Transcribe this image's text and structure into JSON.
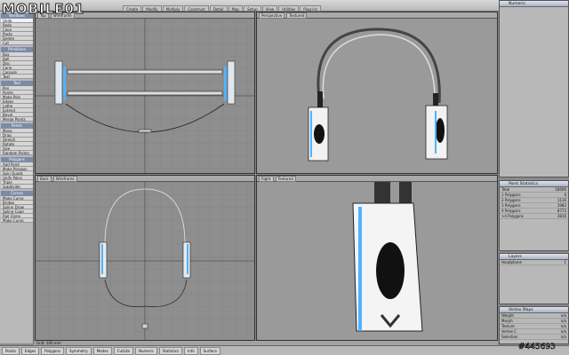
{
  "logo_text": "MOBILE01",
  "watermark": "#445693",
  "menu_tabs": [
    "Create",
    "Modify",
    "Multiply",
    "Construct",
    "Detail",
    "Map",
    "Setup",
    "View",
    "Utilities",
    "Plug-ins"
  ],
  "toolbar": {
    "groups": [
      {
        "title": "Windows",
        "items": [
          "Undo",
          "Redo",
          "Copy",
          "Paste",
          "Delete",
          "Cut"
        ]
      },
      {
        "title": "Primitives",
        "items": [
          "Box",
          "Ball",
          "Disc",
          "Cone",
          "Capsule",
          "Text"
        ]
      },
      {
        "title": "Tool",
        "items": [
          "Pen",
          "Points",
          "Make Poly",
          "Edges",
          "Lathe",
          "Extend",
          "Bevel",
          "Merge Points"
        ]
      },
      {
        "title": "Points",
        "items": [
          "Move",
          "Drag",
          "Stretch",
          "Rotate",
          "Size",
          "Random Points"
        ]
      },
      {
        "title": "Polygons",
        "items": [
          "Add Point",
          "Make Polygon",
          "Spin Quads",
          "Unify Polys",
          "Triple",
          "Subdivide"
        ]
      },
      {
        "title": "Curves",
        "items": [
          "Make Curve",
          "Bridge",
          "Spline Draw",
          "Spline Cage",
          "Rail Clone",
          "Make Curve"
        ]
      }
    ]
  },
  "viewports": {
    "top": {
      "label": "Top",
      "mode": "Wireframe"
    },
    "perspective": {
      "label": "Perspective",
      "mode": "Textured"
    },
    "back": {
      "label": "Back",
      "mode": "Wireframe"
    },
    "right": {
      "label": "Right",
      "mode": "Textured"
    }
  },
  "panels": {
    "numeric": {
      "title": "Numeric"
    },
    "point_statistics": {
      "title": "Point Statistics",
      "rows": [
        {
          "label": "Total",
          "value": "18696"
        },
        {
          "label": "1 Polygons",
          "value": "0"
        },
        {
          "label": "2 Polygons",
          "value": "1116"
        },
        {
          "label": "3 Polygons",
          "value": "1982"
        },
        {
          "label": "4 Polygons",
          "value": "8772"
        },
        {
          "label": ">4 Polygons",
          "value": "2816"
        }
      ]
    },
    "layers": {
      "title": "Layers",
      "rows": [
        {
          "label": "Headphone",
          "value": "1"
        }
      ]
    },
    "vertex_maps": {
      "title": "Vertex Maps",
      "rows": [
        {
          "label": "Weight",
          "value": "n/a"
        },
        {
          "label": "Morph",
          "value": "n/a"
        },
        {
          "label": "Texture",
          "value": "n/a"
        },
        {
          "label": "Vertex C",
          "value": "n/a"
        },
        {
          "label": "Selection",
          "value": "n/a"
        }
      ]
    }
  },
  "status_line": "Grid: 100 mm",
  "bottom_bar": [
    "Points",
    "Edges",
    "Polygons",
    "Symmetry",
    "Modes",
    "CutLite",
    "Numeric",
    "Statistics",
    "Info",
    "Surface"
  ],
  "colors": {
    "accent": "#7b8aa6",
    "cable": "#222222",
    "earcup_glow": "#4fb3ff"
  }
}
